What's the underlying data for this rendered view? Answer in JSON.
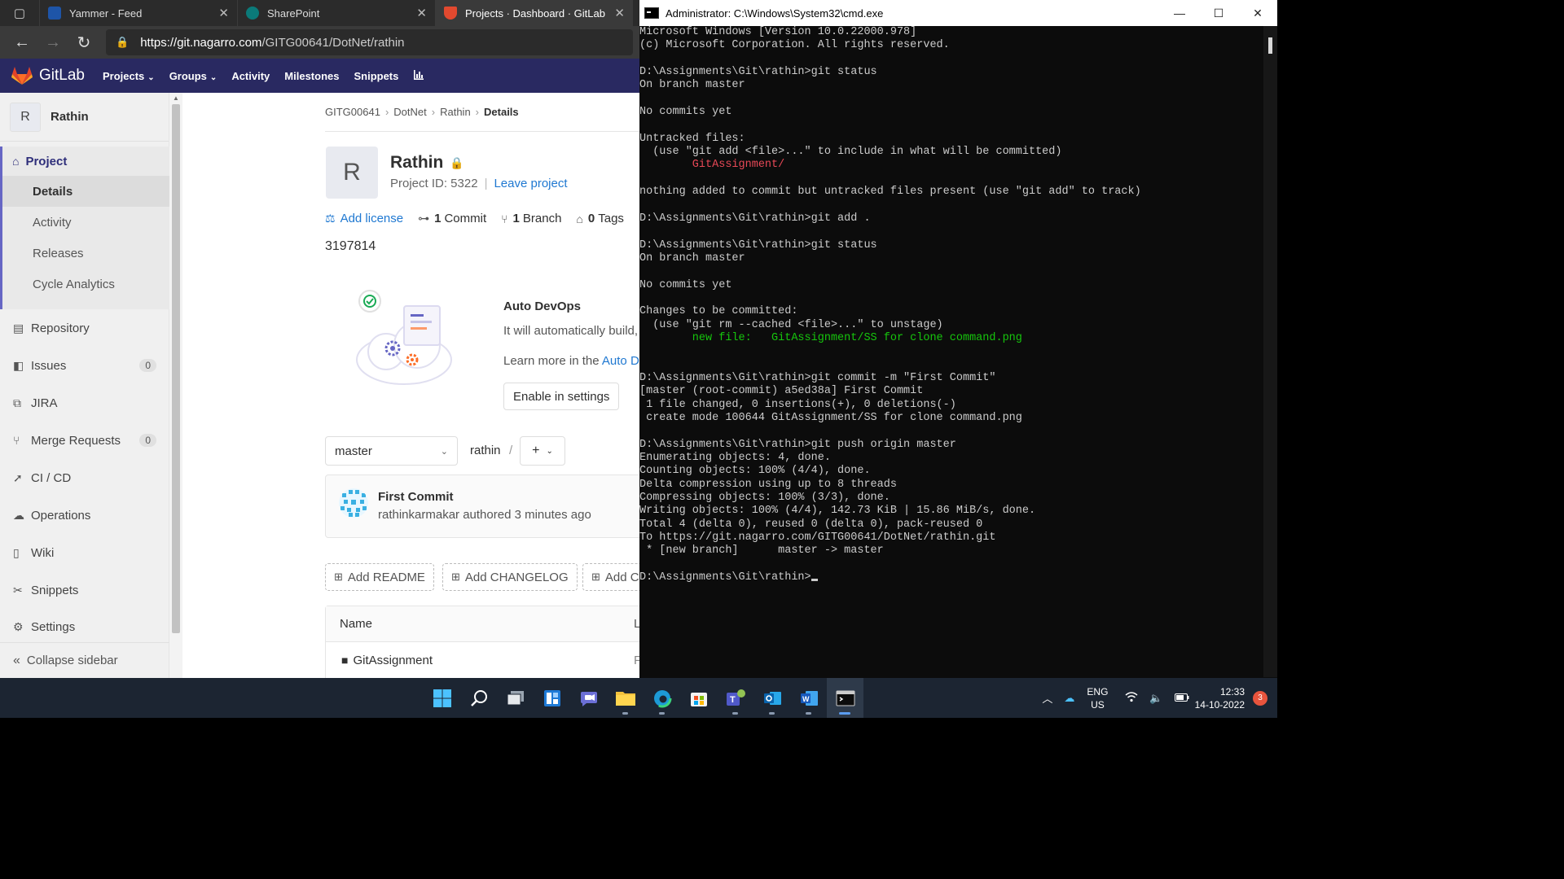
{
  "browser": {
    "tabs": [
      {
        "title": "Yammer - Feed",
        "color": "#1e55a8"
      },
      {
        "title": "SharePoint",
        "color": "#0b7a79"
      },
      {
        "title": "Projects · Dashboard · GitLab",
        "color": "#e2492f"
      }
    ],
    "url_host": "https://git.nagarro.com",
    "url_path": "/GITG00641/DotNet/rathin"
  },
  "gitlab": {
    "brand": "GitLab",
    "nav": {
      "projects": "Projects",
      "groups": "Groups",
      "activity": "Activity",
      "milestones": "Milestones",
      "snippets": "Snippets"
    },
    "sidebar": {
      "avatar_letter": "R",
      "project_name": "Rathin",
      "section": "Project",
      "sub_items": [
        "Details",
        "Activity",
        "Releases",
        "Cycle Analytics"
      ],
      "items": [
        {
          "label": "Repository",
          "icon": "repository-icon"
        },
        {
          "label": "Issues",
          "icon": "issues-icon",
          "badge": "0"
        },
        {
          "label": "JIRA",
          "icon": "jira-icon"
        },
        {
          "label": "Merge Requests",
          "icon": "merge-request-icon",
          "badge": "0"
        },
        {
          "label": "CI / CD",
          "icon": "rocket-icon"
        },
        {
          "label": "Operations",
          "icon": "cloud-icon"
        },
        {
          "label": "Wiki",
          "icon": "book-icon"
        },
        {
          "label": "Snippets",
          "icon": "scissors-icon"
        },
        {
          "label": "Settings",
          "icon": "gear-icon"
        }
      ],
      "collapse": "Collapse sidebar"
    },
    "breadcrumb": [
      "GITG00641",
      "DotNet",
      "Rathin",
      "Details"
    ],
    "project": {
      "avatar_letter": "R",
      "title": "Rathin",
      "id_text": "Project ID: 5322",
      "leave": "Leave project",
      "add_license": "Add license",
      "commits_count": "1",
      "commits_label": "Commit",
      "branches_count": "1",
      "branches_label": "Branch",
      "tags_count": "0",
      "tags_label": "Tags",
      "description": "3197814"
    },
    "devops": {
      "title": "Auto DevOps",
      "text": "It will automatically build, t",
      "more_prefix": "Learn more in the ",
      "more_link": "Auto De",
      "button": "Enable in settings"
    },
    "repo": {
      "branch": "master",
      "path": "rathin",
      "path_sep": "/",
      "add": "+"
    },
    "commit": {
      "title": "First Commit",
      "author": "rathinkarmakar authored 3 minutes ago"
    },
    "quick_buttons": [
      "Add README",
      "Add CHANGELOG",
      "Add C"
    ],
    "files": {
      "header_name": "Name",
      "header_col2": "L",
      "rows": [
        {
          "name": "GitAssignment",
          "col2": "F"
        }
      ]
    }
  },
  "cmd": {
    "title": "Administrator: C:\\Windows\\System32\\cmd.exe",
    "lines": [
      {
        "t": "Microsoft Windows [Version 10.0.22000.978]"
      },
      {
        "t": "(c) Microsoft Corporation. All rights reserved."
      },
      {
        "t": ""
      },
      {
        "t": "D:\\Assignments\\Git\\rathin>git status"
      },
      {
        "t": "On branch master"
      },
      {
        "t": ""
      },
      {
        "t": "No commits yet"
      },
      {
        "t": ""
      },
      {
        "t": "Untracked files:"
      },
      {
        "t": "  (use \"git add <file>...\" to include in what will be committed)"
      },
      {
        "t": "        GitAssignment/",
        "c": "red"
      },
      {
        "t": ""
      },
      {
        "t": "nothing added to commit but untracked files present (use \"git add\" to track)"
      },
      {
        "t": ""
      },
      {
        "t": "D:\\Assignments\\Git\\rathin>git add ."
      },
      {
        "t": ""
      },
      {
        "t": "D:\\Assignments\\Git\\rathin>git status"
      },
      {
        "t": "On branch master"
      },
      {
        "t": ""
      },
      {
        "t": "No commits yet"
      },
      {
        "t": ""
      },
      {
        "t": "Changes to be committed:"
      },
      {
        "t": "  (use \"git rm --cached <file>...\" to unstage)"
      },
      {
        "t": "        new file:   GitAssignment/SS for clone command.png",
        "c": "green"
      },
      {
        "t": ""
      },
      {
        "t": ""
      },
      {
        "t": "D:\\Assignments\\Git\\rathin>git commit -m \"First Commit\""
      },
      {
        "t": "[master (root-commit) a5ed38a] First Commit"
      },
      {
        "t": " 1 file changed, 0 insertions(+), 0 deletions(-)"
      },
      {
        "t": " create mode 100644 GitAssignment/SS for clone command.png"
      },
      {
        "t": ""
      },
      {
        "t": "D:\\Assignments\\Git\\rathin>git push origin master"
      },
      {
        "t": "Enumerating objects: 4, done."
      },
      {
        "t": "Counting objects: 100% (4/4), done."
      },
      {
        "t": "Delta compression using up to 8 threads"
      },
      {
        "t": "Compressing objects: 100% (3/3), done."
      },
      {
        "t": "Writing objects: 100% (4/4), 142.73 KiB | 15.86 MiB/s, done."
      },
      {
        "t": "Total 4 (delta 0), reused 0 (delta 0), pack-reused 0"
      },
      {
        "t": "To https://git.nagarro.com/GITG00641/DotNet/rathin.git"
      },
      {
        "t": " * [new branch]      master -> master"
      },
      {
        "t": ""
      },
      {
        "t": "D:\\Assignments\\Git\\rathin>",
        "cursor": true
      }
    ]
  },
  "taskbar": {
    "lang_1": "ENG",
    "lang_2": "US",
    "time": "12:33",
    "date": "14-10-2022",
    "notifications": "3"
  }
}
